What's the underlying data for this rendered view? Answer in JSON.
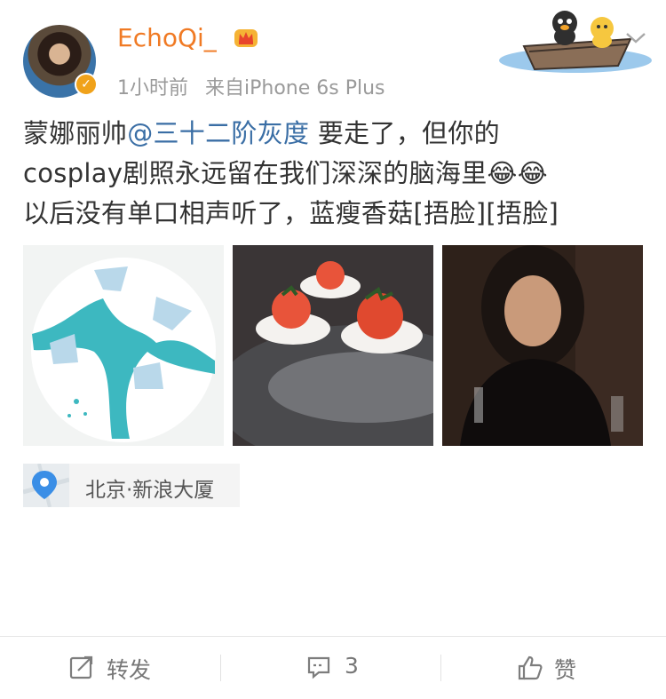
{
  "user": {
    "name": "EchoQi_",
    "time": "1小时前",
    "source": "来自iPhone 6s Plus"
  },
  "post": {
    "line1_a": "蒙娜丽帅",
    "mention": "@三十二阶灰度",
    "line1_b": " 要走了，但你的",
    "line2": "cosplay剧照永远留在我们深深的脑海里",
    "emoji1": "😂",
    "emoji2": "😂",
    "line3": "以后没有单口相声听了，蓝瘦香菇[捂脸][捂脸]"
  },
  "location": {
    "label": "北京·新浪大厦"
  },
  "actions": {
    "repost_label": "转发",
    "comment_count": "3",
    "like_label": "赞"
  },
  "colors": {
    "username": "#f07a24",
    "mention": "#3a6ea5",
    "meta": "#9a9a9a"
  }
}
